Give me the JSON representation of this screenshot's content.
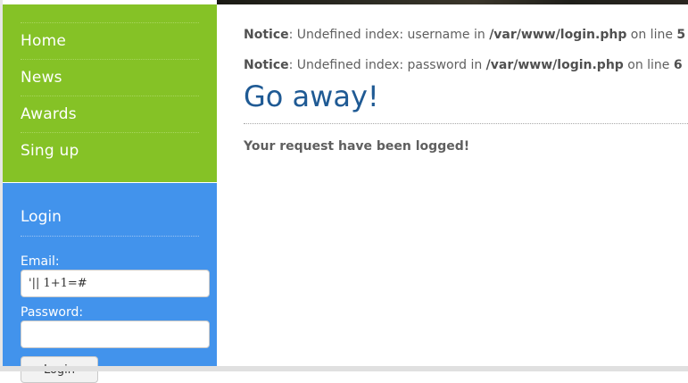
{
  "nav": {
    "items": [
      {
        "label": "Home"
      },
      {
        "label": "News"
      },
      {
        "label": "Awards"
      },
      {
        "label": "Sing up"
      }
    ]
  },
  "login": {
    "title": "Login",
    "email_label": "Email:",
    "email_value": "'|| 1+1=#",
    "password_label": "Password:",
    "password_value": "",
    "button_label": "Login"
  },
  "notices": [
    {
      "prefix": "Notice",
      "text": ": Undefined index: username in ",
      "file": "/var/www/login.php",
      "mid": " on line ",
      "line": "5"
    },
    {
      "prefix": "Notice",
      "text": ": Undefined index: password in ",
      "file": "/var/www/login.php",
      "mid": " on line ",
      "line": "6"
    }
  ],
  "main": {
    "heading": "Go away!",
    "message": "Your request have been logged!"
  },
  "colors": {
    "nav_bg": "#85c226",
    "login_bg": "#4293ec",
    "heading": "#1f5a94"
  }
}
